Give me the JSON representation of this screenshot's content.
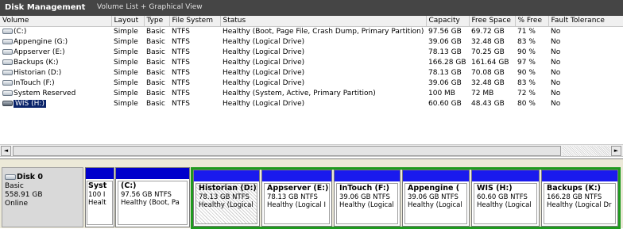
{
  "window": {
    "title": "Disk Management",
    "view": "Volume List + Graphical View"
  },
  "columns": [
    "Volume",
    "Layout",
    "Type",
    "File System",
    "Status",
    "Capacity",
    "Free Space",
    "% Free",
    "Fault Tolerance"
  ],
  "volumes": [
    {
      "name": "(C:)",
      "layout": "Simple",
      "type": "Basic",
      "fs": "NTFS",
      "status": "Healthy (Boot, Page File, Crash Dump, Primary Partition)",
      "capacity": "97.56 GB",
      "free": "69.72 GB",
      "pct": "71 %",
      "fault": "No"
    },
    {
      "name": "Appengine (G:)",
      "layout": "Simple",
      "type": "Basic",
      "fs": "NTFS",
      "status": "Healthy (Logical Drive)",
      "capacity": "39.06 GB",
      "free": "32.48 GB",
      "pct": "83 %",
      "fault": "No"
    },
    {
      "name": "Appserver (E:)",
      "layout": "Simple",
      "type": "Basic",
      "fs": "NTFS",
      "status": "Healthy (Logical Drive)",
      "capacity": "78.13 GB",
      "free": "70.25 GB",
      "pct": "90 %",
      "fault": "No"
    },
    {
      "name": "Backups (K:)",
      "layout": "Simple",
      "type": "Basic",
      "fs": "NTFS",
      "status": "Healthy (Logical Drive)",
      "capacity": "166.28 GB",
      "free": "161.64 GB",
      "pct": "97 %",
      "fault": "No"
    },
    {
      "name": "Historian (D:)",
      "layout": "Simple",
      "type": "Basic",
      "fs": "NTFS",
      "status": "Healthy (Logical Drive)",
      "capacity": "78.13 GB",
      "free": "70.08 GB",
      "pct": "90 %",
      "fault": "No"
    },
    {
      "name": "InTouch (F:)",
      "layout": "Simple",
      "type": "Basic",
      "fs": "NTFS",
      "status": "Healthy (Logical Drive)",
      "capacity": "39.06 GB",
      "free": "32.48 GB",
      "pct": "83 %",
      "fault": "No"
    },
    {
      "name": "System Reserved",
      "layout": "Simple",
      "type": "Basic",
      "fs": "NTFS",
      "status": "Healthy (System, Active, Primary Partition)",
      "capacity": "100 MB",
      "free": "72 MB",
      "pct": "72 %",
      "fault": "No"
    },
    {
      "name": "WIS (H:)",
      "layout": "Simple",
      "type": "Basic",
      "fs": "NTFS",
      "status": "Healthy (Logical Drive)",
      "capacity": "60.60 GB",
      "free": "48.43 GB",
      "pct": "80 %",
      "fault": "No",
      "selected": true
    }
  ],
  "disk": {
    "name": "Disk 0",
    "kind": "Basic",
    "size": "558.91 GB",
    "state": "Online"
  },
  "partitions": [
    {
      "name": "Syst",
      "size": "100 I",
      "status": "Healt"
    },
    {
      "name": "(C:)",
      "size": "97.56 GB NTFS",
      "status": "Healthy (Boot, Pa"
    },
    {
      "name": "Historian  (D:)",
      "size": "78.13 GB NTFS",
      "status": "Healthy (Logical"
    },
    {
      "name": "Appserver  (E:)",
      "size": "78.13 GB NTFS",
      "status": "Healthy (Logical I"
    },
    {
      "name": "InTouch  (F:)",
      "size": "39.06 GB NTFS",
      "status": "Healthy (Logical"
    },
    {
      "name": "Appengine  (",
      "size": "39.06 GB NTFS",
      "status": "Healthy (Logical"
    },
    {
      "name": "WIS  (H:)",
      "size": "60.60 GB NTFS",
      "status": "Healthy (Logical"
    },
    {
      "name": "Backups  (K:)",
      "size": "166.28 GB NTFS",
      "status": "Healthy (Logical Dr"
    }
  ],
  "colors": {
    "primary_bar": "#0000cc",
    "logical_bar": "#1a1aee",
    "extended_border": "#1e9a1e",
    "selection": "#0a246a"
  },
  "icons": {
    "volume": "drive-icon",
    "disk": "disk-icon",
    "scroll_left": "◄",
    "scroll_right": "►"
  }
}
